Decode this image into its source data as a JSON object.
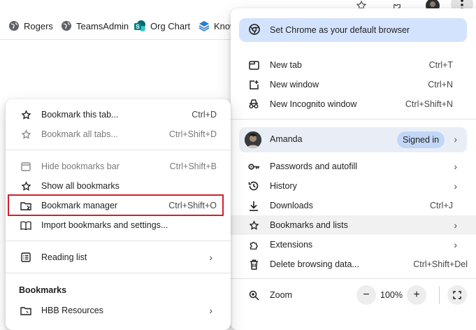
{
  "toolbar": {
    "icons": [
      "star-icon",
      "extensions-icon",
      "avatar",
      "kebab-menu-icon"
    ]
  },
  "bookmarks_bar": {
    "items": [
      {
        "label": "Rogers",
        "icon": "globe-icon"
      },
      {
        "label": "TeamsAdmin",
        "icon": "globe-icon"
      },
      {
        "label": "Org Chart",
        "icon": "sharepoint-icon"
      },
      {
        "label": "Know",
        "icon": "stack-icon"
      }
    ]
  },
  "main_menu": {
    "default_banner": "Set Chrome as your default browser",
    "group1": [
      {
        "label": "New tab",
        "shortcut": "Ctrl+T",
        "icon": "new-tab-icon"
      },
      {
        "label": "New window",
        "shortcut": "Ctrl+N",
        "icon": "new-window-icon"
      },
      {
        "label": "New Incognito window",
        "shortcut": "Ctrl+Shift+N",
        "icon": "incognito-icon"
      }
    ],
    "profile": {
      "name": "Amanda",
      "status": "Signed in"
    },
    "group2": [
      {
        "label": "Passwords and autofill",
        "icon": "key-icon"
      },
      {
        "label": "History",
        "icon": "history-icon"
      },
      {
        "label": "Downloads",
        "shortcut": "Ctrl+J",
        "icon": "download-icon"
      },
      {
        "label": "Bookmarks and lists",
        "icon": "star-icon"
      },
      {
        "label": "Extensions",
        "icon": "puzzle-icon"
      },
      {
        "label": "Delete browsing data...",
        "shortcut": "Ctrl+Shift+Del",
        "icon": "trash-icon"
      }
    ],
    "zoom": {
      "label": "Zoom",
      "value": "100%",
      "minus": "−",
      "plus": "+"
    }
  },
  "bookmarks_submenu": {
    "group1": [
      {
        "label": "Bookmark this tab...",
        "shortcut": "Ctrl+D",
        "icon": "star-outline-icon"
      },
      {
        "label": "Bookmark all tabs...",
        "shortcut": "Ctrl+Shift+D",
        "icon": "star-outline-icon",
        "disabled": true
      }
    ],
    "group2": [
      {
        "label": "Hide bookmarks bar",
        "shortcut": "Ctrl+Shift+B",
        "icon": "bookmarks-bar-icon",
        "disabled": true
      },
      {
        "label": "Show all bookmarks",
        "icon": "star-outline-icon"
      },
      {
        "label": "Bookmark manager",
        "shortcut": "Ctrl+Shift+O",
        "icon": "folder-manager-icon"
      },
      {
        "label": "Import bookmarks and settings...",
        "icon": "import-book-icon"
      }
    ],
    "reading_list": {
      "label": "Reading list",
      "icon": "reading-list-icon"
    },
    "bookmarks_heading": "Bookmarks",
    "folders": [
      {
        "label": "HBB Resources",
        "icon": "folder-icon"
      }
    ]
  },
  "colors": {
    "banner_bg": "#d3e3fd",
    "profile_bg": "#e9eef6",
    "signed_in_badge": "#c2d7f7",
    "highlight_box": "#d0202e",
    "sharepoint": "#038387",
    "stack_icon": "#2b7cd3"
  }
}
